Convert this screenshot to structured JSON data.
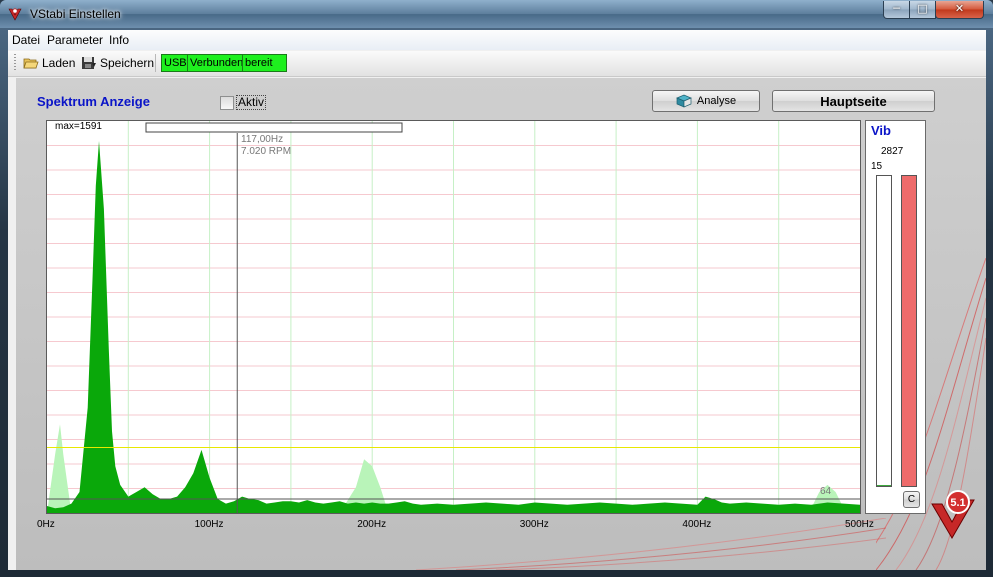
{
  "window": {
    "title": "VStabi Einstellen"
  },
  "menu": {
    "items": [
      "Datei",
      "Parameter",
      "Info"
    ]
  },
  "toolbar": {
    "load_label": "Laden",
    "save_label": "Speichern",
    "usb_label": "USB",
    "status_connected": "Verbunden",
    "status_ready": "bereit"
  },
  "spectrum": {
    "title": "Spektrum Anzeige",
    "active_label": "Aktiv",
    "active_checked": false,
    "analyse_button": "Analyse",
    "main_button": "Hauptseite",
    "max_label": "max=1591",
    "cursor_freq": "117,00Hz",
    "cursor_rpm": "7.020 RPM",
    "marker_value": "64"
  },
  "vib": {
    "title": "Vib",
    "value": "2827",
    "scale": "15",
    "clear_button": "C",
    "left_bar_level": 0.0,
    "right_bar_level": 1.0
  },
  "colors": {
    "spectrum_fill": "#0aa80a",
    "ghost_fill": "#b9f4b9",
    "threshold_line": "#e8e800",
    "title_blue": "#0a14c8",
    "vib_bar": "#ee6b6b"
  },
  "chart_data": {
    "type": "area",
    "x_unit": "Hz",
    "xlim": [
      0,
      500
    ],
    "ylim": [
      0,
      1591
    ],
    "x_ticks": [
      "0Hz",
      "100Hz",
      "200Hz",
      "300Hz",
      "400Hz",
      "500Hz"
    ],
    "cursor_x": 117,
    "threshold_y": 280,
    "series": [
      {
        "x": [
          0,
          5,
          10,
          15,
          20,
          25,
          28,
          30,
          32,
          35,
          38,
          40,
          42,
          45,
          50,
          55,
          60,
          65,
          70,
          75,
          80,
          85,
          90,
          95,
          100,
          105,
          110,
          115,
          120,
          125,
          130,
          135,
          140,
          145,
          150,
          155,
          160,
          165,
          170,
          175,
          180,
          185,
          190,
          195,
          200,
          205,
          210,
          215,
          220,
          225,
          230,
          240,
          250,
          260,
          270,
          280,
          290,
          300,
          310,
          320,
          330,
          340,
          350,
          360,
          370,
          380,
          390,
          400,
          405,
          410,
          415,
          420,
          430,
          440,
          450,
          460,
          470,
          480,
          490,
          500
        ],
        "values": [
          30,
          20,
          25,
          40,
          90,
          450,
          1000,
          1400,
          1591,
          1300,
          700,
          350,
          200,
          120,
          70,
          90,
          110,
          80,
          60,
          60,
          70,
          110,
          170,
          270,
          150,
          60,
          40,
          50,
          70,
          60,
          55,
          40,
          45,
          50,
          50,
          45,
          55,
          45,
          40,
          45,
          50,
          40,
          45,
          40,
          45,
          40,
          40,
          45,
          50,
          40,
          35,
          40,
          35,
          40,
          45,
          40,
          35,
          45,
          40,
          35,
          40,
          45,
          40,
          35,
          40,
          45,
          40,
          35,
          70,
          60,
          45,
          40,
          45,
          40,
          35,
          40,
          35,
          45,
          40,
          35
        ]
      },
      {
        "x": [
          0,
          5,
          8,
          10,
          15,
          180,
          190,
          195,
          200,
          205,
          210,
          460,
          470,
          475,
          480,
          485,
          490,
          500
        ],
        "values": [
          0,
          250,
          380,
          250,
          0,
          0,
          110,
          230,
          200,
          110,
          0,
          0,
          20,
          90,
          120,
          90,
          20,
          0
        ]
      }
    ]
  }
}
